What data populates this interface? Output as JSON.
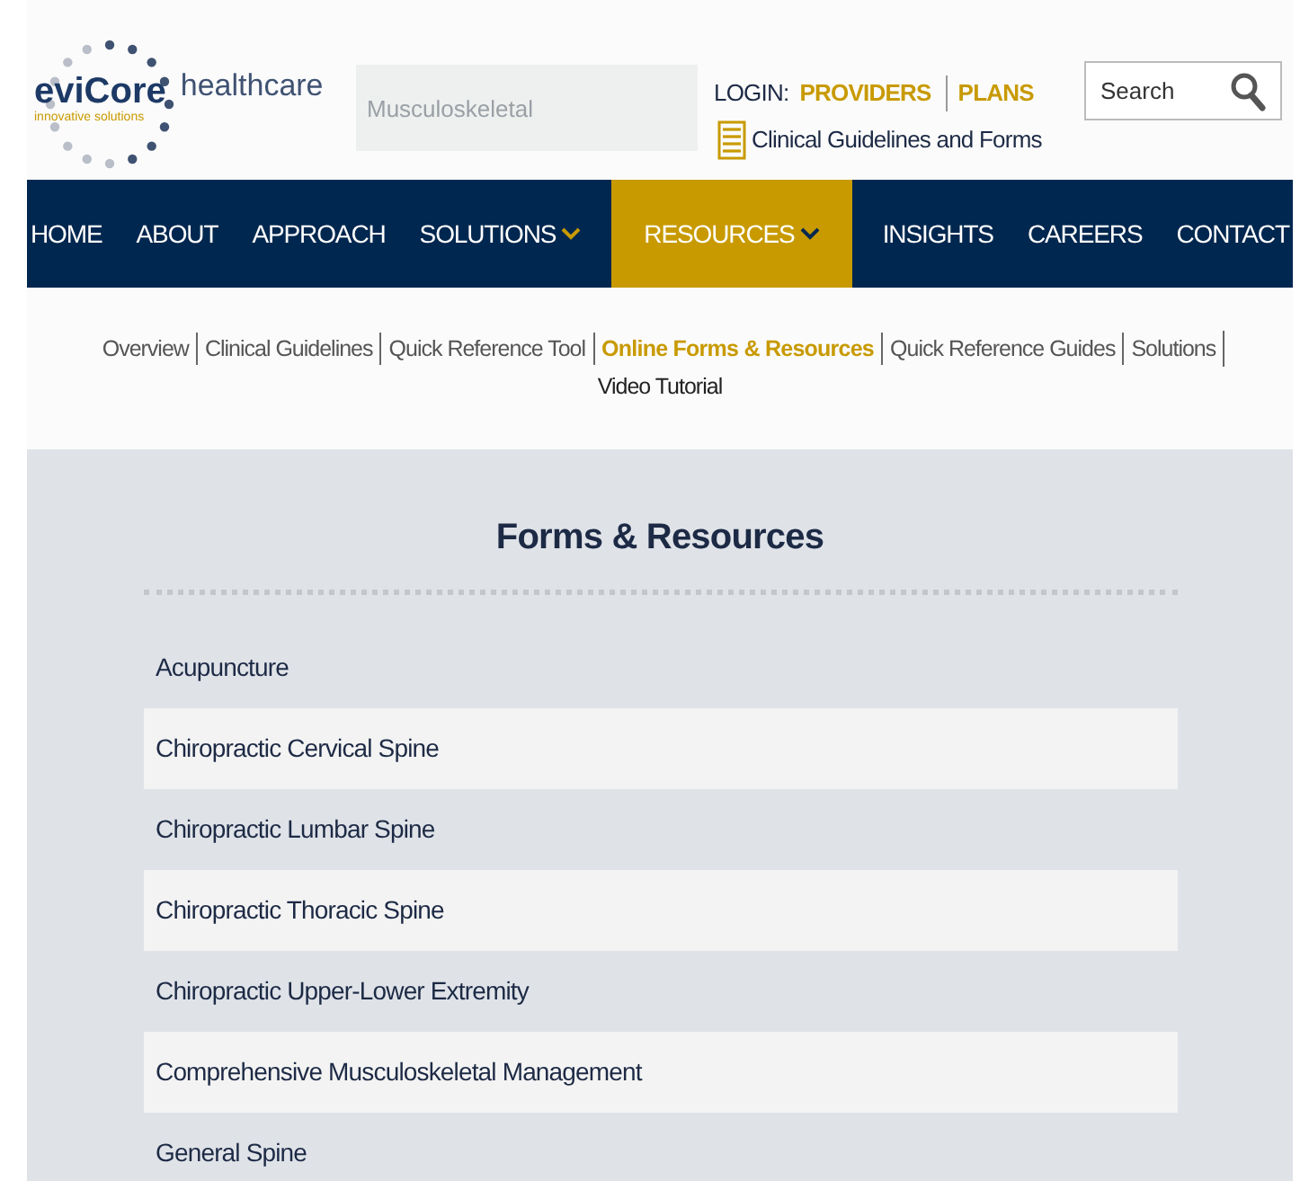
{
  "logo": {
    "brand": "eviCore",
    "suffix": "healthcare",
    "tagline": "innovative solutions"
  },
  "search_box": {
    "value": "Musculoskeletal"
  },
  "login": {
    "label": "LOGIN:",
    "links": [
      "PROVIDERS",
      "PLANS"
    ]
  },
  "guidelines_link": "Clinical Guidelines and Forms",
  "site_search": {
    "placeholder": "Search"
  },
  "nav": [
    {
      "label": "HOME",
      "selected": false,
      "dropdown": false
    },
    {
      "label": "ABOUT",
      "selected": false,
      "dropdown": false
    },
    {
      "label": "APPROACH",
      "selected": false,
      "dropdown": false
    },
    {
      "label": "SOLUTIONS",
      "selected": false,
      "dropdown": true
    },
    {
      "label": "RESOURCES",
      "selected": true,
      "dropdown": true
    },
    {
      "label": "INSIGHTS",
      "selected": false,
      "dropdown": false
    },
    {
      "label": "CAREERS",
      "selected": false,
      "dropdown": false
    },
    {
      "label": "CONTACT",
      "selected": false,
      "dropdown": false
    }
  ],
  "subnav": [
    {
      "label": "Overview",
      "selected": false
    },
    {
      "label": "Clinical Guidelines",
      "selected": false
    },
    {
      "label": "Quick Reference Tool",
      "selected": false
    },
    {
      "label": "Online Forms & Resources",
      "selected": true
    },
    {
      "label": "Quick Reference Guides",
      "selected": false
    },
    {
      "label": "Solutions",
      "selected": false
    },
    {
      "label": "Video Tutorial",
      "selected": false
    }
  ],
  "panel": {
    "title": "Forms & Resources",
    "items": [
      "Acupuncture",
      "Chiropractic Cervical Spine",
      "Chiropractic Lumbar Spine",
      "Chiropractic Thoracic Spine",
      "Chiropractic Upper-Lower Extremity",
      "Comprehensive Musculoskeletal Management",
      "General Spine"
    ]
  }
}
